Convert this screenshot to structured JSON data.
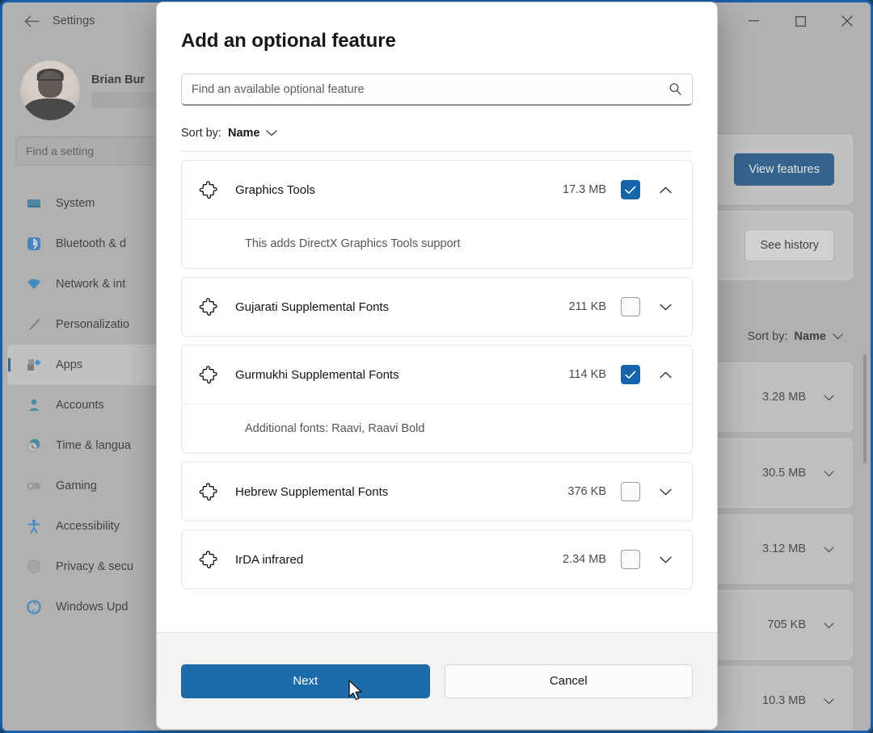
{
  "window": {
    "title": "Settings",
    "back_icon": "back-arrow-icon",
    "controls": {
      "minimize": "minimize-icon",
      "maximize": "maximize-icon",
      "close": "close-icon"
    }
  },
  "sidebar": {
    "profile": {
      "name": "Brian Bur",
      "email_redacted": ""
    },
    "search": {
      "placeholder": "Find a setting",
      "value": ""
    },
    "items": [
      {
        "label": "System",
        "icon": "monitor-icon",
        "active": false
      },
      {
        "label": "Bluetooth & d",
        "icon": "bluetooth-icon",
        "active": false
      },
      {
        "label": "Network & int",
        "icon": "wifi-icon",
        "active": false
      },
      {
        "label": "Personalizatio",
        "icon": "paintbrush-icon",
        "active": false
      },
      {
        "label": "Apps",
        "icon": "apps-icon",
        "active": true
      },
      {
        "label": "Accounts",
        "icon": "person-icon",
        "active": false
      },
      {
        "label": "Time & langua",
        "icon": "clock-icon",
        "active": false
      },
      {
        "label": "Gaming",
        "icon": "gamepad-icon",
        "active": false
      },
      {
        "label": "Accessibility",
        "icon": "accessibility-icon",
        "active": false
      },
      {
        "label": "Privacy & secu",
        "icon": "shield-icon",
        "active": false
      },
      {
        "label": "Windows Upd",
        "icon": "update-icon",
        "active": false
      }
    ]
  },
  "background_content": {
    "view_features_label": "View features",
    "see_history_label": "See history",
    "sort_by_prefix": "Sort by:",
    "sort_by_value": "Name",
    "rows": [
      {
        "size": "3.28 MB",
        "chevron": "chevron-down-icon"
      },
      {
        "size": "30.5 MB",
        "chevron": "chevron-down-icon"
      },
      {
        "size": "3.12 MB",
        "chevron": "chevron-down-icon"
      },
      {
        "size": "705 KB",
        "chevron": "chevron-down-icon"
      },
      {
        "size": "10.3 MB",
        "chevron": "chevron-down-icon"
      }
    ]
  },
  "dialog": {
    "title": "Add an optional feature",
    "search": {
      "placeholder": "Find an available optional feature",
      "value": "",
      "icon": "search-icon"
    },
    "sort_by_prefix": "Sort by:",
    "sort_by_value": "Name",
    "sort_by_chevron": "chevron-down-icon",
    "features": [
      {
        "name": "Graphics Tools",
        "size": "17.3 MB",
        "checked": true,
        "expanded": true,
        "description": "This adds DirectX Graphics Tools support"
      },
      {
        "name": "Gujarati Supplemental Fonts",
        "size": "211 KB",
        "checked": false,
        "expanded": false,
        "description": ""
      },
      {
        "name": "Gurmukhi Supplemental Fonts",
        "size": "114 KB",
        "checked": true,
        "expanded": true,
        "description": "Additional fonts: Raavi, Raavi Bold"
      },
      {
        "name": "Hebrew Supplemental Fonts",
        "size": "376 KB",
        "checked": false,
        "expanded": false,
        "description": ""
      },
      {
        "name": "IrDA infrared",
        "size": "2.34 MB",
        "checked": false,
        "expanded": false,
        "description": ""
      }
    ],
    "footer": {
      "next_label": "Next",
      "cancel_label": "Cancel"
    }
  },
  "colors": {
    "accent_blue": "#1d6bab",
    "checkbox_blue": "#1565ad",
    "window_border": "#1b5ea8",
    "button_blue": "#0d4b86"
  }
}
